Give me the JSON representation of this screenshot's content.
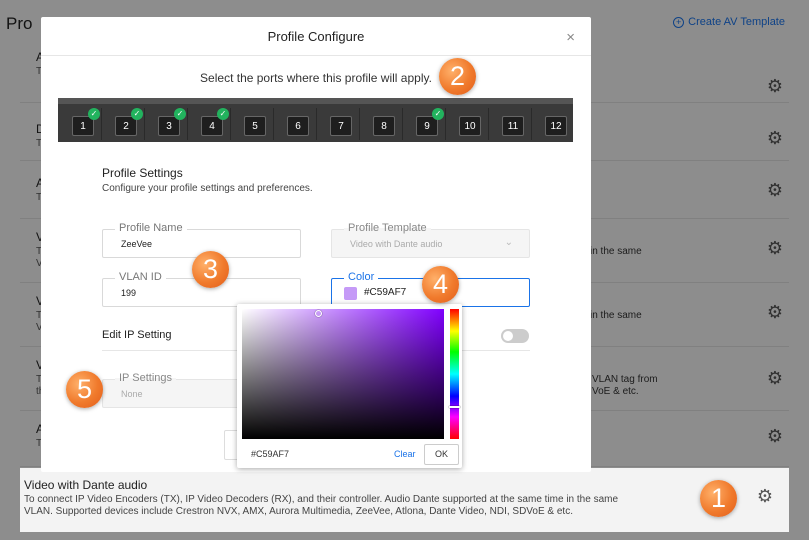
{
  "background": {
    "page_title": "Pro",
    "create_link": "Create AV Template",
    "rows": [
      {
        "t": "A",
        "d": "T",
        "d2": "",
        "right": ""
      },
      {
        "t": "D",
        "d": "T",
        "d2": "",
        "right": ""
      },
      {
        "t": "A",
        "d": "T",
        "d2": "",
        "right": ""
      },
      {
        "t": "V",
        "d": "T",
        "d2": "V",
        "right": "in the same"
      },
      {
        "t": "V",
        "d": "T",
        "d2": "V",
        "right": "in the same"
      },
      {
        "t": "V",
        "d": "T",
        "d2": "th",
        "right": "VLAN tag from",
        "right2": "VoE & etc."
      },
      {
        "t": "A",
        "d": "T",
        "d2": "",
        "right": ""
      }
    ],
    "last_row": {
      "title": "Video with Dante audio",
      "desc1": "To connect IP Video Encoders (TX), IP Video Decoders (RX), and their controller. Audio Dante supported at the same time in the same",
      "desc2": "VLAN. Supported devices include Crestron NVX, AMX, Aurora Multimedia, ZeeVee, Atlona, Dante Video, NDI, SDVoE & etc."
    }
  },
  "modal": {
    "title": "Profile Configure",
    "close": "×",
    "port_caption": "Select the ports where this profile will apply.",
    "ports": [
      {
        "n": "1",
        "checked": true
      },
      {
        "n": "2",
        "checked": true
      },
      {
        "n": "3",
        "checked": true
      },
      {
        "n": "4",
        "checked": true
      },
      {
        "n": "5",
        "checked": false
      },
      {
        "n": "6",
        "checked": false
      },
      {
        "n": "7",
        "checked": false
      },
      {
        "n": "8",
        "checked": false
      },
      {
        "n": "9",
        "checked": true
      },
      {
        "n": "10",
        "checked": false
      },
      {
        "n": "11",
        "checked": false
      },
      {
        "n": "12",
        "checked": false
      }
    ],
    "section_title": "Profile Settings",
    "section_sub": "Configure your profile settings and preferences.",
    "profile_name_label": "Profile Name",
    "profile_name_value": "ZeeVee",
    "profile_template_label": "Profile Template",
    "profile_template_value": "Video with Dante audio",
    "vlan_label": "VLAN ID",
    "vlan_value": "199",
    "color_label": "Color",
    "color_value": "#C59AF7",
    "edit_ip_label": "Edit IP Setting",
    "ip_settings_label": "IP Settings",
    "ip_settings_value": "None"
  },
  "picker": {
    "hex": "#C59AF7",
    "clear": "Clear",
    "ok": "OK"
  },
  "badges": [
    "1",
    "2",
    "3",
    "4",
    "5"
  ],
  "colors": {
    "accent": "#1a73e8",
    "swatch": "#C59AF7",
    "check": "#22b35e",
    "badge": "#f07a2c"
  }
}
